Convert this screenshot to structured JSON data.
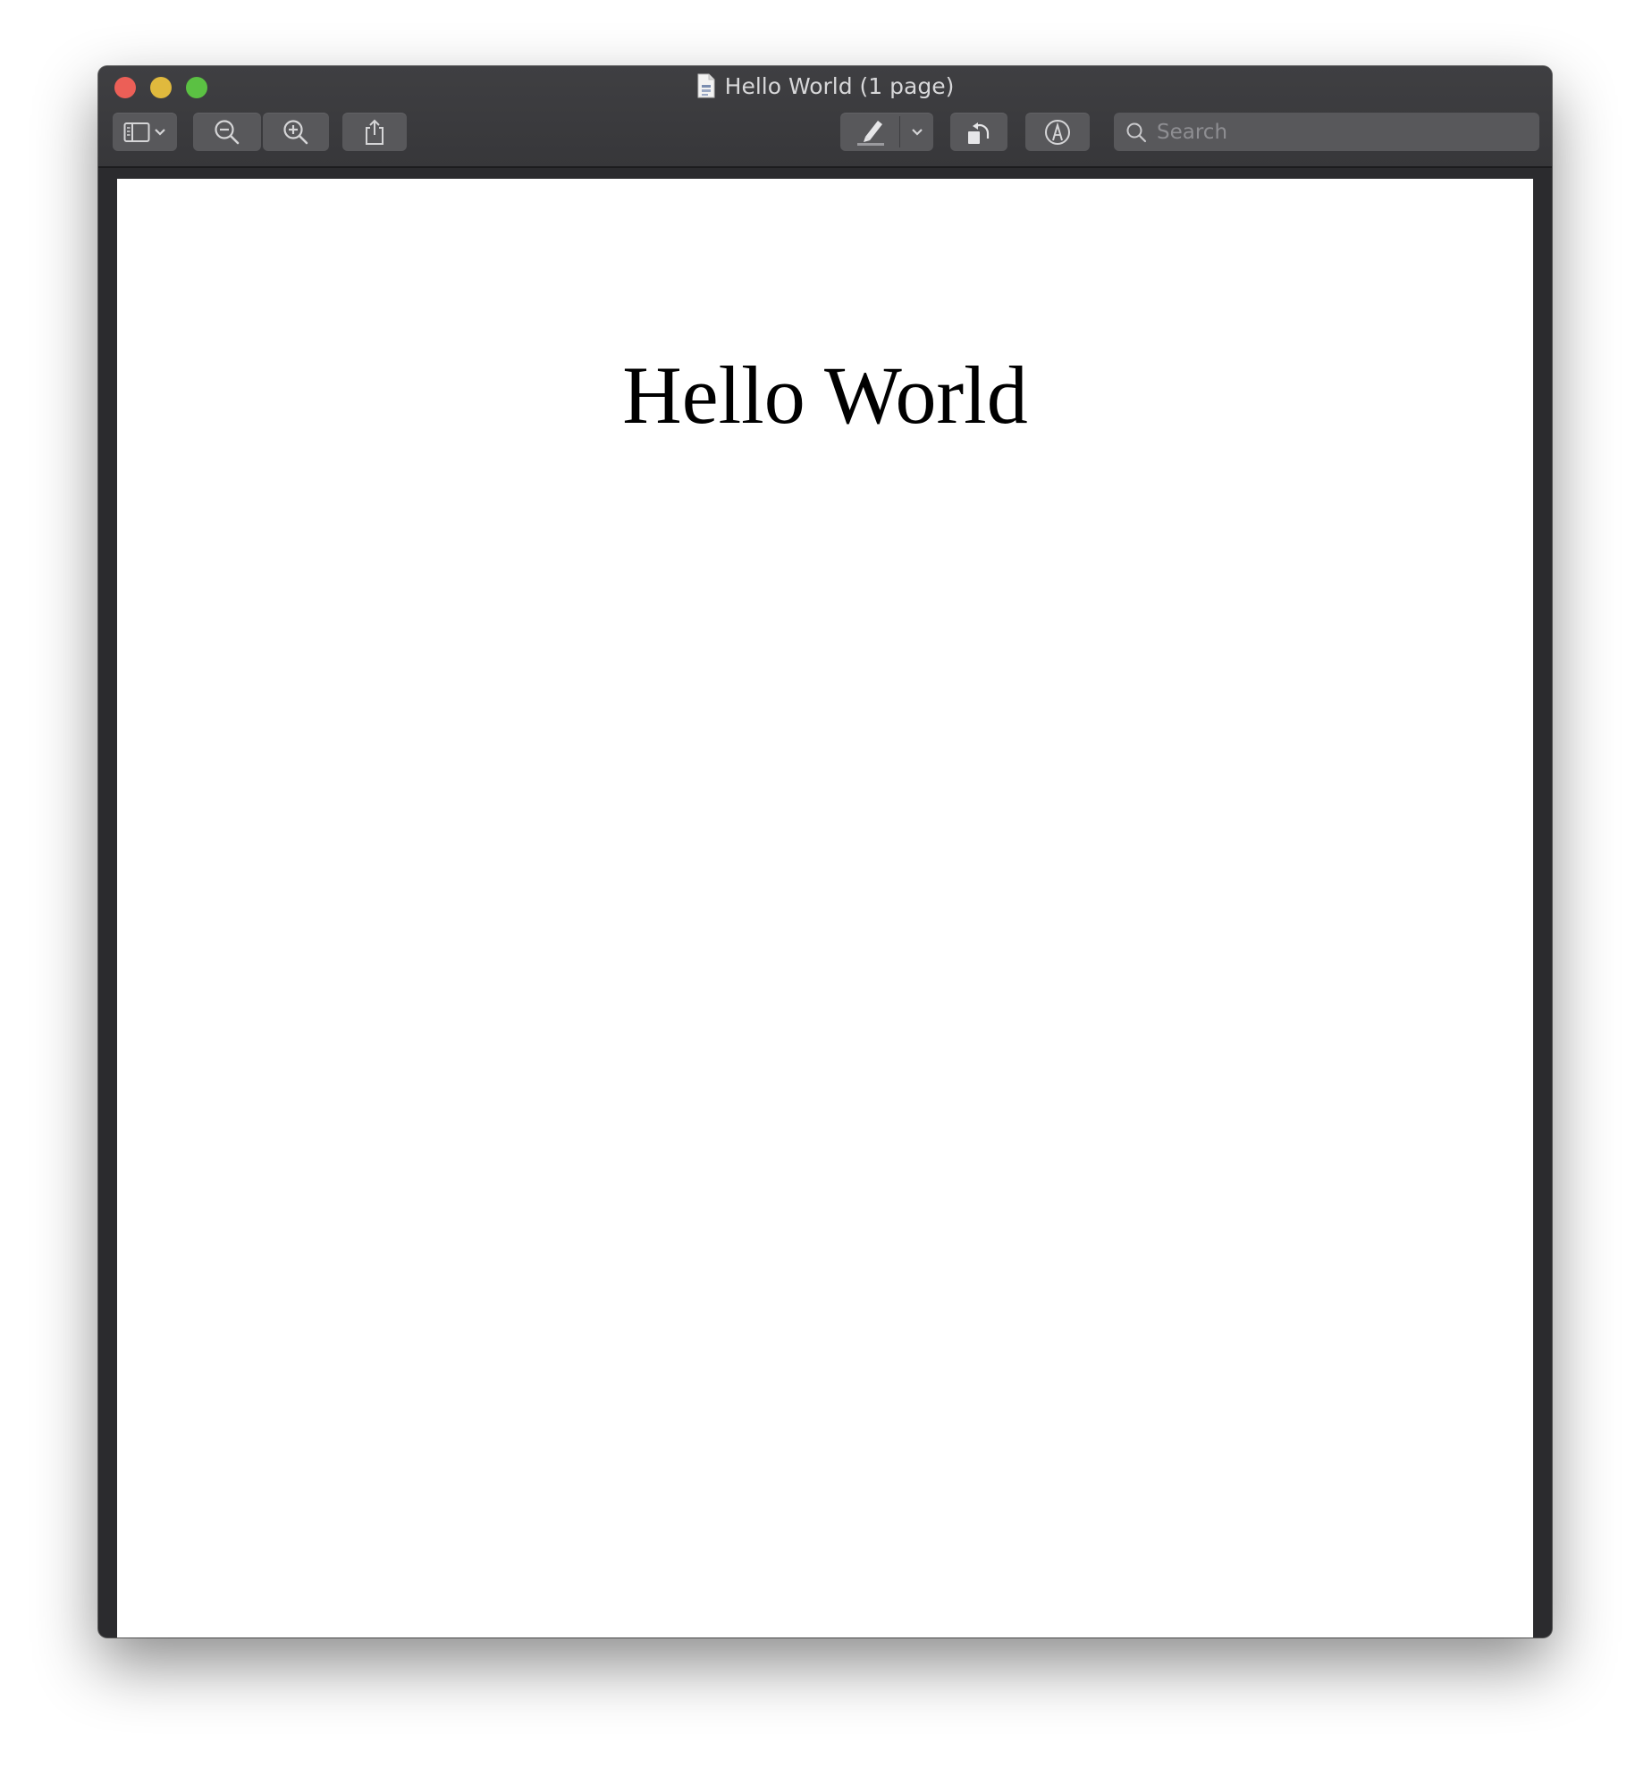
{
  "window": {
    "title": "Hello World (1 page)",
    "traffic_lights": {
      "close_color": "#ec5f57",
      "minimize_color": "#e0b93d",
      "maximize_color": "#5bc143"
    }
  },
  "toolbar": {
    "sidebar_toggle_icon": "sidebar-icon",
    "sidebar_menu_icon": "chevron-down-icon",
    "zoom_out_icon": "zoom-out-icon",
    "zoom_in_icon": "zoom-in-icon",
    "share_icon": "share-icon",
    "highlight_icon": "highlighter-icon",
    "highlight_menu_icon": "chevron-down-icon",
    "rotate_icon": "rotate-left-icon",
    "markup_icon": "markup-icon",
    "search": {
      "placeholder": "Search",
      "value": ""
    }
  },
  "document": {
    "heading": "Hello World"
  }
}
